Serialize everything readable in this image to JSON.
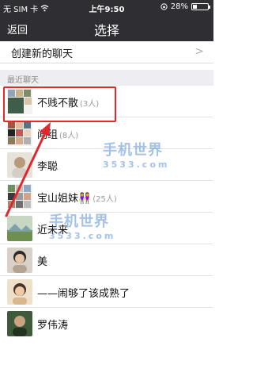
{
  "status": {
    "carrier": "无 SIM 卡",
    "time": "上午9:50",
    "battery": "28%",
    "battery_level": 0.28
  },
  "nav": {
    "back_label": "返回",
    "title": "选择"
  },
  "new_chat": {
    "label": "创建新的聊天",
    "chevron": ">"
  },
  "section": {
    "recent_label": "最近聊天"
  },
  "chats": [
    {
      "name": "不贱不散",
      "count": "(3人)",
      "avatar": "group-grid-avatar"
    },
    {
      "name": "闻组",
      "count": "(8人)",
      "avatar": "group-grid-avatar"
    },
    {
      "name": "李聪",
      "count": "",
      "avatar": "person-avatar"
    },
    {
      "name": "宝山姐妹👭",
      "count": "(25人)",
      "avatar": "group-grid-avatar"
    },
    {
      "name": "近未来",
      "count": "",
      "avatar": "landscape-avatar"
    },
    {
      "name": "美",
      "count": "",
      "avatar": "person-avatar"
    },
    {
      "name": "——闹够了该成熟了",
      "count": "",
      "avatar": "person-avatar"
    },
    {
      "name": "罗伟涛",
      "count": "",
      "avatar": "person-avatar"
    }
  ],
  "watermark": {
    "brand": "手机世界",
    "number": "3533.com"
  },
  "colors": {
    "header_bg": "#2e2e33",
    "highlight": "#e2282f",
    "section_bg": "#eeeef2"
  }
}
